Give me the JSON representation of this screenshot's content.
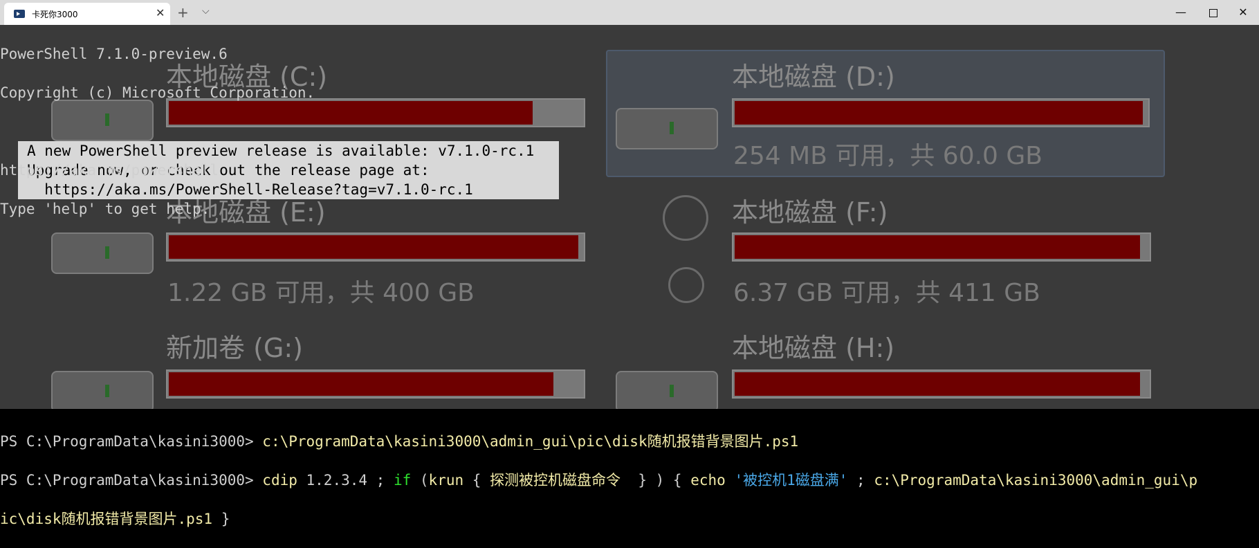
{
  "window": {
    "tab_title": "卡死你3000",
    "tab_icon": "powershell-icon",
    "tab_close": "✕",
    "new_tab": "+",
    "dropdown": "⌵",
    "minimize": "—",
    "close": "✕"
  },
  "background": {
    "drives": [
      {
        "name": "本地磁盘 (C:)",
        "used_fraction": 0.88
      },
      {
        "name": "本地磁盘 (D:)",
        "free": "254 MB 可用，共 60.0 GB",
        "used_fraction": 0.99
      },
      {
        "name": "本地磁盘 (E:)",
        "free": "1.22 GB 可用，共 400 GB",
        "used_fraction": 0.99
      },
      {
        "name": "本地磁盘 (F:)",
        "free": "6.37 GB 可用，共 411 GB",
        "used_fraction": 0.98
      },
      {
        "name": "新加卷 (G:)",
        "used_fraction": 0.93
      },
      {
        "name": "本地磁盘 (H:)",
        "used_fraction": 0.98
      }
    ]
  },
  "terminal": {
    "line1": "PowerShell 7.1.0-preview.6",
    "line2": "Copyright (c) Microsoft Corporation.",
    "line3": "https://aka.ms/powershell",
    "line4": "Type 'help' to get help.",
    "notice": [
      "A new PowerShell preview release is available: v7.1.0-rc.1",
      "Upgrade now, or check out the release page at:",
      "  https://aka.ms/PowerShell-Release?tag=v7.1.0-rc.1"
    ],
    "prompt1": "PS C:\\ProgramData\\kasini3000> ",
    "cmd1": "c:\\ProgramData\\kasini3000\\admin_gui\\pic\\disk随机报错背景图片.ps1",
    "prompt2": "PS C:\\ProgramData\\kasini3000> ",
    "cmd2_a": "cdip",
    "cmd2_b": " 1.2.3.4 ; ",
    "cmd2_if": "if",
    "cmd2_c": " (",
    "cmd2_krun": "krun",
    "cmd2_d": " { ",
    "cmd2_e": "探测被控机磁盘命令",
    "cmd2_f": "  } ) { ",
    "cmd2_echo": "echo",
    "cmd2_g": " ",
    "cmd2_str": "'被控机1磁盘满'",
    "cmd2_h": " ; ",
    "cmd2_path": "c:\\ProgramData\\kasini3000\\admin_gui\\p",
    "cmd2_path2": "ic\\disk随机报错背景图片.ps1",
    "cmd2_end": " }"
  }
}
